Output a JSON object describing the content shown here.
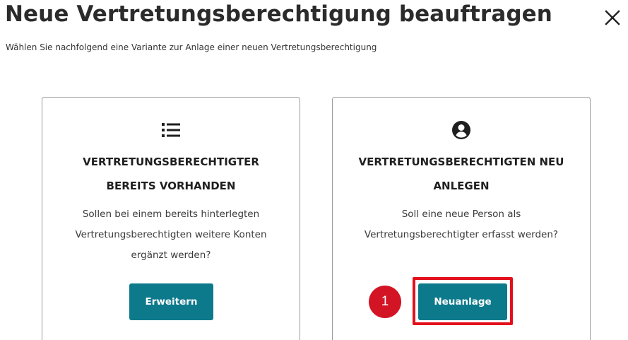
{
  "dialog": {
    "title": "Neue Vertretungsberechtigung beauftragen",
    "subtitle": "Wählen Sie nachfolgend eine Variante zur Anlage einer neuen Vertretungsberechtigung",
    "close_icon": "close-icon"
  },
  "cards": [
    {
      "icon": "list-icon",
      "heading": "VERTRETUNGSBERECHTIGTER BEREITS VORHANDEN",
      "text": "Sollen bei einem bereits hinterlegten Vertretungsberechtigten weitere Konten ergänzt werden?",
      "button_label": "Erweitern"
    },
    {
      "icon": "person-circle-icon",
      "heading": "VERTRETUNGSBERECHTIGTEN NEU ANLEGEN",
      "text": "Soll eine neue Person als Vertretungsberechtigter erfasst werden?",
      "button_label": "Neuanlage"
    }
  ],
  "annotation": {
    "step_number": "1"
  },
  "colors": {
    "button": "#0d7a8c",
    "highlight": "#e3101c",
    "badge": "#d21424",
    "card_border": "#9a9a9a"
  }
}
